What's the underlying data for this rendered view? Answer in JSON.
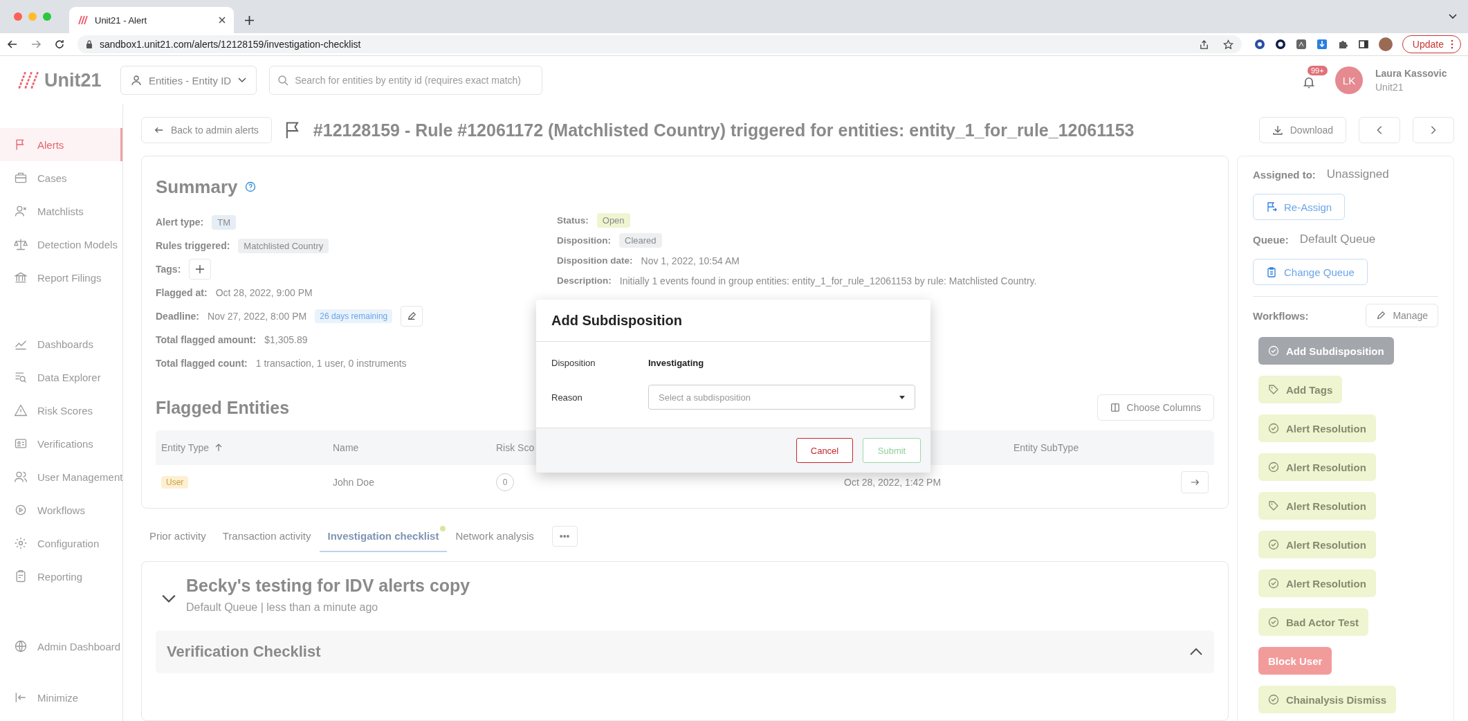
{
  "browser": {
    "tab_title": "Unit21 - Alert",
    "url": "sandbox1.unit21.com/alerts/12128159/investigation-checklist",
    "update_button": "Update"
  },
  "header": {
    "logo": "Unit21",
    "entity_selector": "Entities - Entity ID",
    "search": {
      "placeholder": "Search for entities by entity id (requires exact match)"
    },
    "notification_badge": "99+",
    "user": {
      "initials": "LK",
      "name": "Laura Kassovic",
      "organization": "Unit21"
    }
  },
  "sidebar": {
    "items": [
      {
        "label": "Alerts",
        "selected": true
      },
      {
        "label": "Cases",
        "selected": false
      },
      {
        "label": "Matchlists",
        "selected": false
      },
      {
        "label": "Detection Models",
        "selected": false
      },
      {
        "label": "Report Filings",
        "selected": false
      },
      {
        "label": "Dashboards",
        "selected": false
      },
      {
        "label": "Data Explorer",
        "selected": false
      },
      {
        "label": "Risk Scores",
        "selected": false
      },
      {
        "label": "Verifications",
        "selected": false
      },
      {
        "label": "User Management",
        "selected": false
      },
      {
        "label": "Workflows",
        "selected": false
      },
      {
        "label": "Configuration",
        "selected": false
      },
      {
        "label": "Reporting",
        "selected": false
      }
    ],
    "admin_dashboard": "Admin Dashboard",
    "minimize": "Minimize"
  },
  "page": {
    "back_button": "Back to admin alerts",
    "title": "#12128159 - Rule #12061172 (Matchlisted Country) triggered for entities: entity_1_for_rule_12061153",
    "download_button": "Download"
  },
  "summary": {
    "title": "Summary",
    "left_fields": [
      {
        "kind": "tag",
        "label": "Alert type:",
        "value": "TM",
        "color": "#e6edf5"
      },
      {
        "kind": "tag",
        "label": "Rules triggered:",
        "value": "Matchlisted Country",
        "color": "#eeeff1"
      },
      {
        "kind": "add",
        "label": "Tags:"
      },
      {
        "kind": "text",
        "label": "Flagged at:",
        "value": "Oct 28, 2022, 9:00 PM"
      },
      {
        "kind": "deadline",
        "label": "Deadline:",
        "value": "Nov 27, 2022, 8:00 PM",
        "badge": "26 days remaining"
      },
      {
        "kind": "text",
        "label": "Total flagged amount:",
        "value": "$1,305.89"
      },
      {
        "kind": "text",
        "label": "Total flagged count:",
        "value": "1 transaction, 1 user, 0 instruments"
      }
    ],
    "right_fields": [
      {
        "kind": "tag",
        "label": "Status:",
        "value": "Open",
        "color": "#eef5d0"
      },
      {
        "kind": "tag",
        "label": "Disposition:",
        "value": "Cleared",
        "color": "#eeeff1"
      },
      {
        "kind": "text",
        "label": "Disposition date:",
        "value": "Nov 1, 2022, 10:54 AM"
      },
      {
        "kind": "text",
        "label": "Description:",
        "value": "Initially 1 events found in group entities: entity_1_for_rule_12061153 by rule: Matchlisted Country."
      }
    ]
  },
  "flagged_entities": {
    "title": "Flagged Entities",
    "choose_columns_button": "Choose Columns",
    "columns": [
      "Entity Type",
      "Name",
      "Risk Sco",
      "Entity SubType"
    ],
    "rows": [
      {
        "entity_type": "User",
        "name": "John Doe",
        "risk_score": "0",
        "date": "Oct 28, 2022, 1:42 PM"
      }
    ]
  },
  "tabs": [
    {
      "label": "Prior activity",
      "selected": false,
      "dot": false
    },
    {
      "label": "Transaction activity",
      "selected": false,
      "dot": false
    },
    {
      "label": "Investigation checklist",
      "selected": true,
      "dot": true
    },
    {
      "label": "Network analysis",
      "selected": false,
      "dot": false
    }
  ],
  "more_tabs_button": "•••",
  "checklist": {
    "title": "Becky's testing for IDV alerts copy",
    "subtitle": "Default Queue | less than a minute ago",
    "expanded": true,
    "sections": [
      {
        "title": "Verification Checklist",
        "expanded": true
      }
    ]
  },
  "side_panel": {
    "assigned_label": "Assigned to:",
    "assigned_value": "Unassigned",
    "reassign_button": "Re-Assign",
    "queue_label": "Queue:",
    "queue_value": "Default Queue",
    "change_queue_button": "Change Queue",
    "workflows_label": "Workflows:",
    "manage_button": "Manage",
    "workflows": [
      {
        "kind": "check",
        "label": "Add Subdisposition",
        "color": "#a3a6ab"
      },
      {
        "kind": "tag",
        "label": "Add Tags",
        "color": "#eef5d0"
      },
      {
        "kind": "check",
        "label": "Alert Resolution",
        "color": "#eef5d0"
      },
      {
        "kind": "check",
        "label": "Alert Resolution",
        "color": "#eef5d0"
      },
      {
        "kind": "tag",
        "label": "Alert Resolution",
        "color": "#eef5d0"
      },
      {
        "kind": "check",
        "label": "Alert Resolution",
        "color": "#eef5d0"
      },
      {
        "kind": "check",
        "label": "Alert Resolution",
        "color": "#eef5d0"
      },
      {
        "kind": "check",
        "label": "Bad Actor Test",
        "color": "#eef5d0"
      },
      {
        "kind": "plain",
        "label": "Block User",
        "color": "#f29b9b"
      },
      {
        "kind": "check",
        "label": "Chainalysis Dismiss",
        "color": "#eef5d0"
      }
    ]
  },
  "modal": {
    "title": "Add Subdisposition",
    "disposition_label": "Disposition",
    "disposition_value": "Investigating",
    "reason_label": "Reason",
    "reason_select": {
      "placeholder": "Select a subdisposition"
    },
    "cancel_button": "Cancel",
    "submit_button": "Submit",
    "submit_disabled": true
  }
}
